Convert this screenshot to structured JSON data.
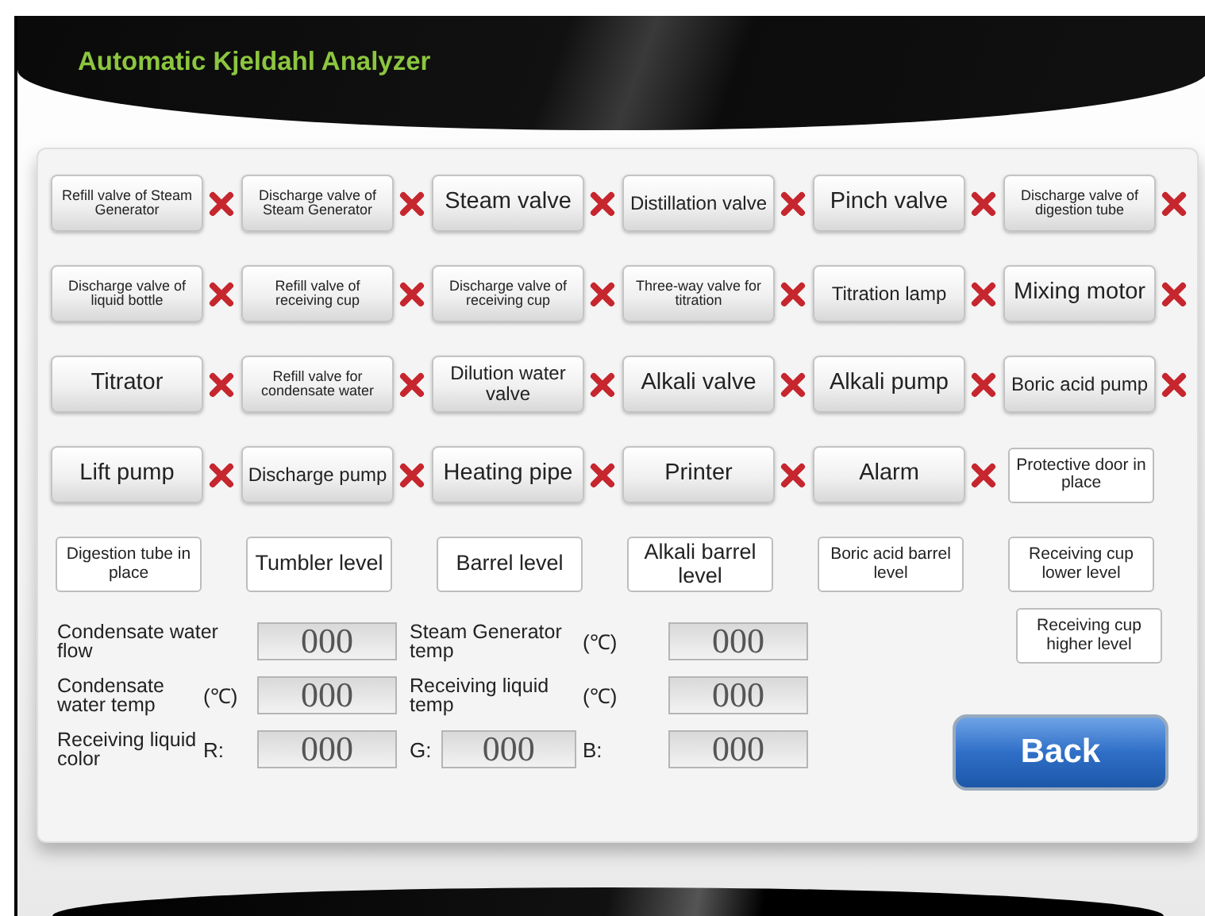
{
  "title": "Automatic Kjeldahl Analyzer",
  "controls": [
    {
      "kind": "output",
      "label": "Refill valve of Steam Generator",
      "fault": true
    },
    {
      "kind": "output",
      "label": "Discharge valve of Steam Generator",
      "fault": true
    },
    {
      "kind": "output",
      "label": "Steam valve",
      "fault": true
    },
    {
      "kind": "output",
      "label": "Distillation valve",
      "fault": true
    },
    {
      "kind": "output",
      "label": "Pinch valve",
      "fault": true
    },
    {
      "kind": "output",
      "label": "Discharge valve of digestion tube",
      "fault": true
    },
    {
      "kind": "output",
      "label": "Discharge valve of liquid bottle",
      "fault": true
    },
    {
      "kind": "output",
      "label": "Refill valve of receiving cup",
      "fault": true
    },
    {
      "kind": "output",
      "label": "Discharge valve of receiving cup",
      "fault": true
    },
    {
      "kind": "output",
      "label": "Three-way valve for titration",
      "fault": true
    },
    {
      "kind": "output",
      "label": "Titration lamp",
      "fault": true
    },
    {
      "kind": "output",
      "label": "Mixing motor",
      "fault": true
    },
    {
      "kind": "output",
      "label": "Titrator",
      "fault": true
    },
    {
      "kind": "output",
      "label": "Refill valve for condensate water",
      "fault": true
    },
    {
      "kind": "output",
      "label": "Dilution water valve",
      "fault": true
    },
    {
      "kind": "output",
      "label": "Alkali valve",
      "fault": true
    },
    {
      "kind": "output",
      "label": "Alkali pump",
      "fault": true
    },
    {
      "kind": "output",
      "label": "Boric acid pump",
      "fault": true
    },
    {
      "kind": "output",
      "label": "Lift pump",
      "fault": true
    },
    {
      "kind": "output",
      "label": "Discharge pump",
      "fault": true
    },
    {
      "kind": "output",
      "label": "Heating pipe",
      "fault": true
    },
    {
      "kind": "output",
      "label": "Printer",
      "fault": true
    },
    {
      "kind": "output",
      "label": "Alarm",
      "fault": true
    },
    {
      "kind": "sensor",
      "label": "Protective door in place"
    },
    {
      "kind": "sensor",
      "label": "Digestion tube in place"
    },
    {
      "kind": "sensor",
      "label": "Tumbler level"
    },
    {
      "kind": "sensor",
      "label": "Barrel level"
    },
    {
      "kind": "sensor",
      "label": "Alkali barrel level"
    },
    {
      "kind": "sensor",
      "label": "Boric acid barrel level"
    },
    {
      "kind": "sensor",
      "label": "Receiving cup lower level"
    }
  ],
  "readings": [
    [
      {
        "kind": "label",
        "text": "Condensate water flow"
      },
      {
        "kind": "value",
        "text": "000"
      },
      {
        "kind": "label",
        "text": "Steam Generator temp"
      },
      {
        "kind": "unit",
        "text": "(℃)"
      },
      {
        "kind": "value",
        "text": "000"
      }
    ],
    [
      {
        "kind": "label",
        "text": "Condensate water temp"
      },
      {
        "kind": "unit",
        "text": "(℃)"
      },
      {
        "kind": "value",
        "text": "000"
      },
      {
        "kind": "label",
        "text": "Receiving liquid temp"
      },
      {
        "kind": "unit",
        "text": "(℃)"
      },
      {
        "kind": "value",
        "text": "000"
      }
    ],
    [
      {
        "kind": "label",
        "text": "Receiving liquid color"
      },
      {
        "kind": "unit",
        "text": "R:"
      },
      {
        "kind": "value",
        "text": "000"
      },
      {
        "kind": "channel",
        "label": "G:",
        "value": "000"
      },
      {
        "kind": "unit",
        "text": "B:"
      },
      {
        "kind": "value",
        "text": "000"
      }
    ]
  ],
  "side_sensors": [
    {
      "kind": "sensor",
      "label": "Receiving cup higher level"
    }
  ],
  "back_button": "Back"
}
